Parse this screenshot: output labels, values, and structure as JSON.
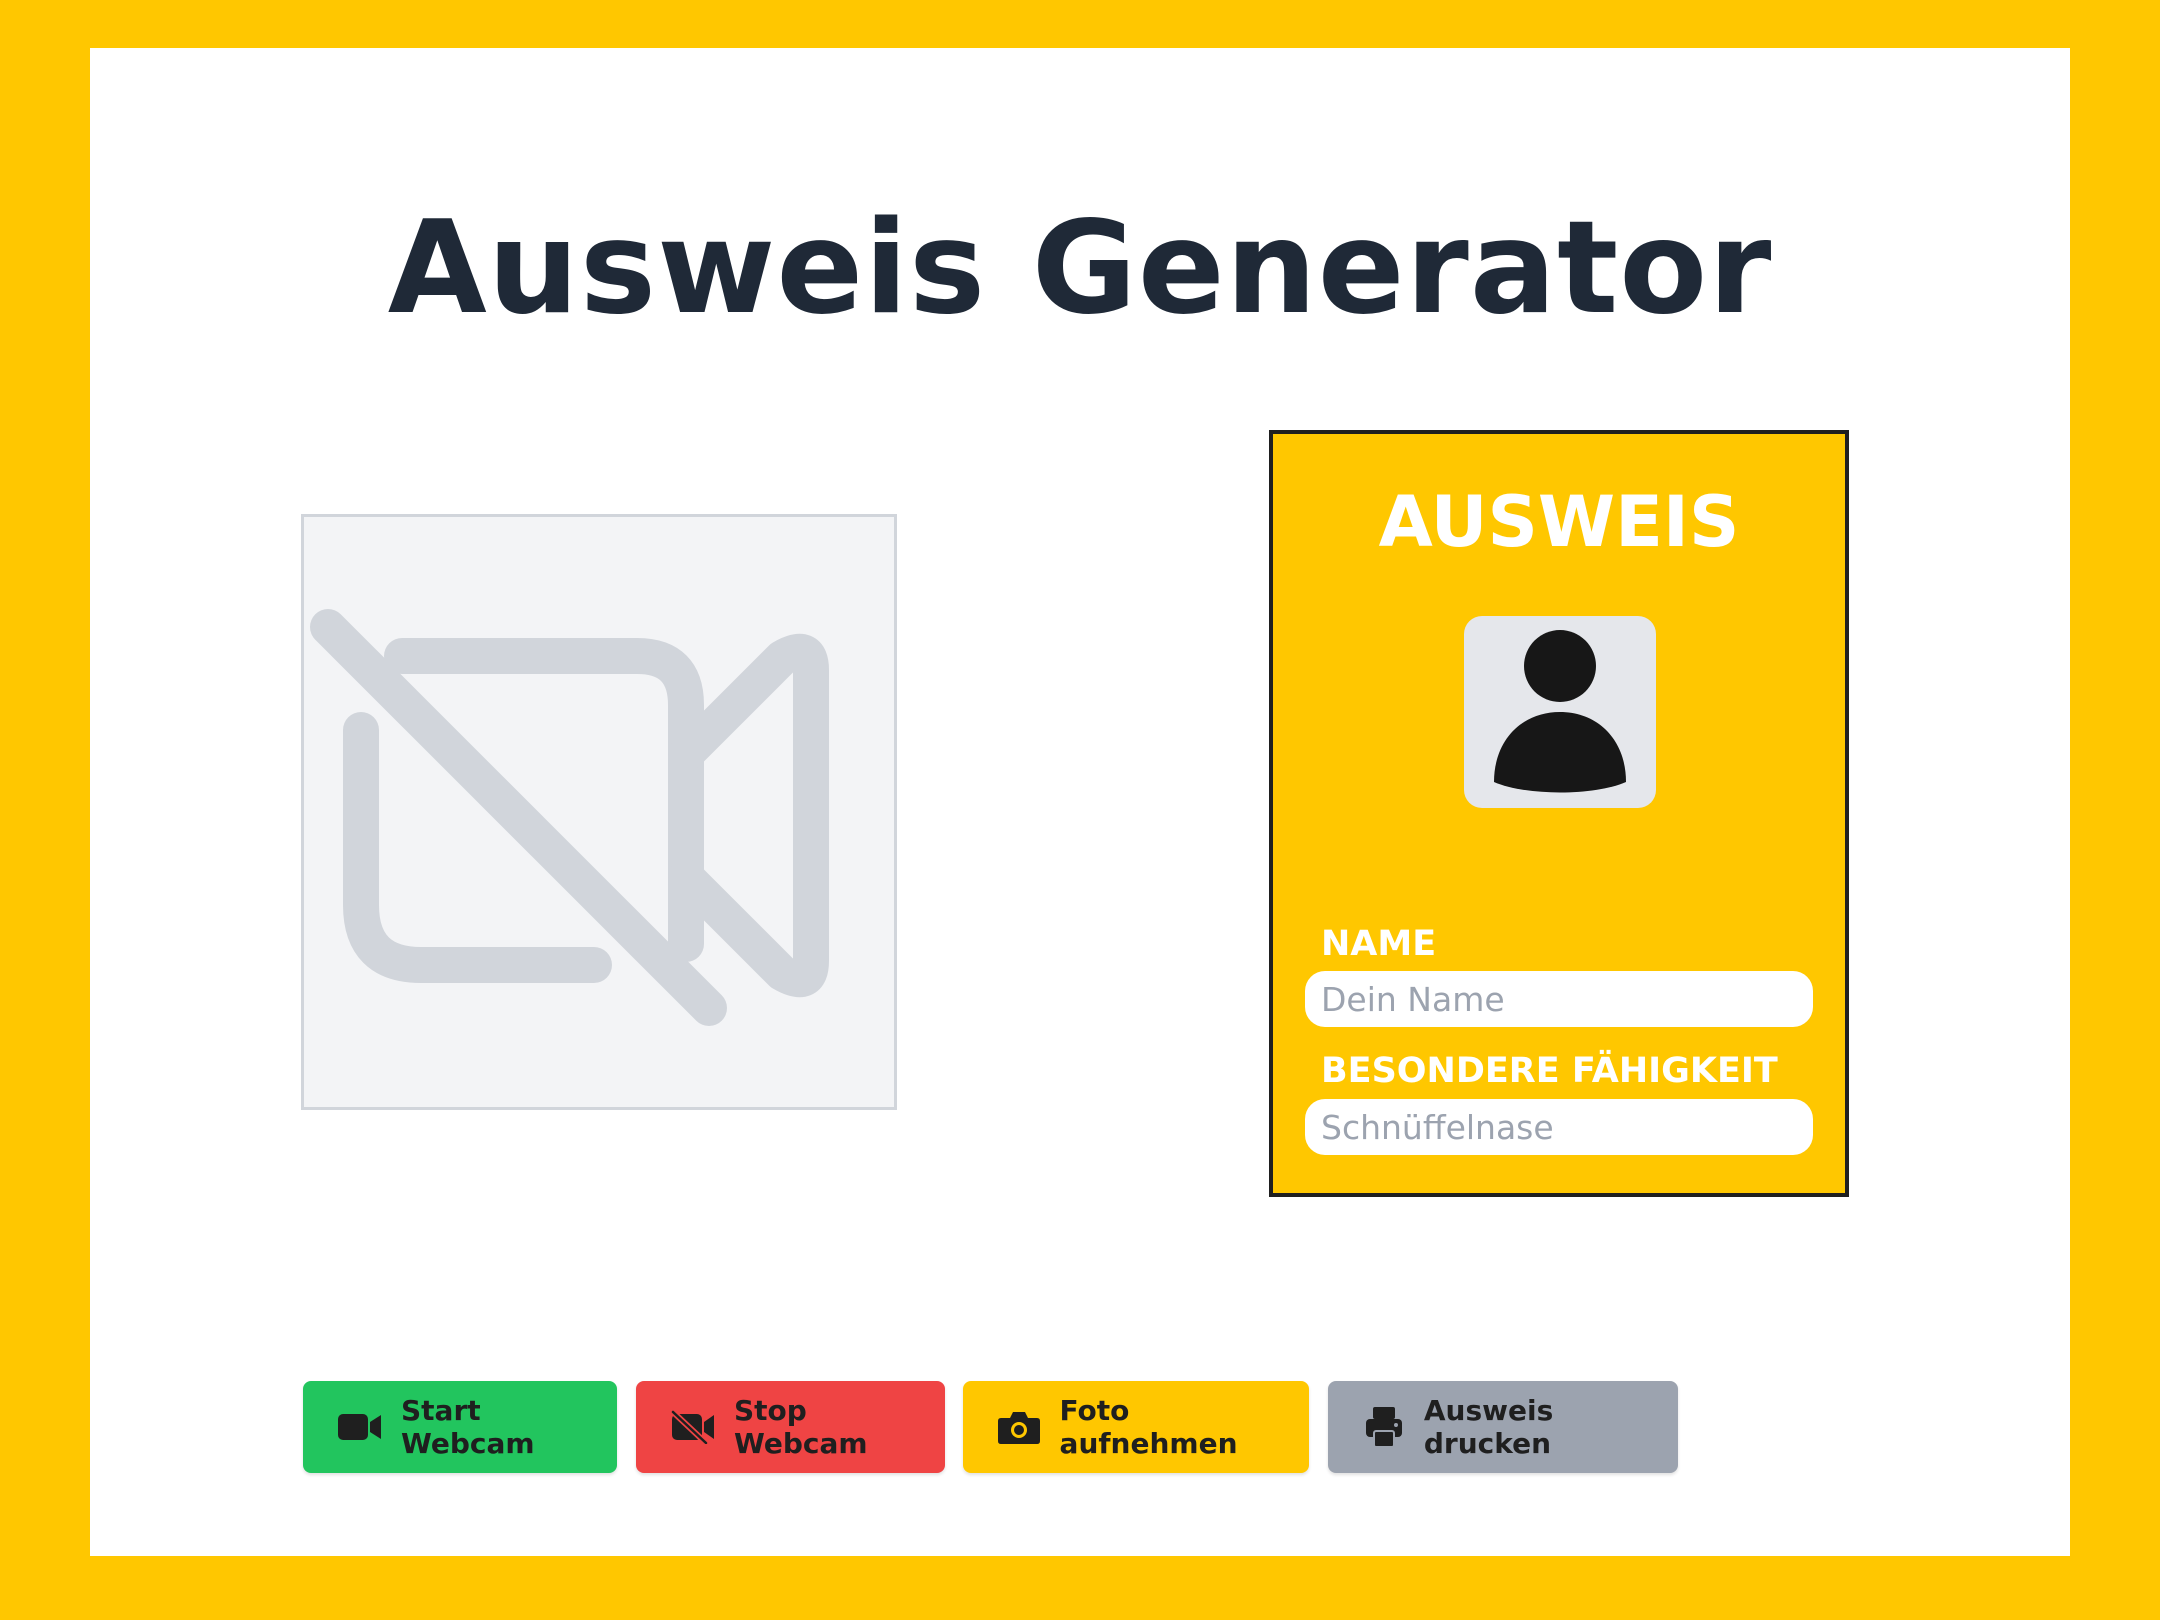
{
  "page": {
    "title": "Ausweis Generator"
  },
  "webcam": {
    "status_icon": "video-off-icon"
  },
  "id_card": {
    "title": "AUSWEIS",
    "photo_icon": "user-silhouette-icon",
    "name_label": "NAME",
    "name_value": "",
    "name_placeholder": "Dein Name",
    "ability_label": "BESONDERE FÄHIGKEIT",
    "ability_value": "",
    "ability_placeholder": "Schnüffelnase"
  },
  "toolbar": {
    "start_label": "Start Webcam",
    "stop_label": "Stop Webcam",
    "photo_label": "Foto aufnehmen",
    "print_label": "Ausweis drucken"
  },
  "colors": {
    "background": "#FFC700",
    "panel": "#FFFFFF",
    "title_text": "#1F2937",
    "start_button": "#22C55E",
    "stop_button": "#EF4444",
    "photo_button": "#FFC700",
    "print_button": "#9CA3AF",
    "card": "#FFC700",
    "placeholder_icon": "#D1D5DB"
  }
}
